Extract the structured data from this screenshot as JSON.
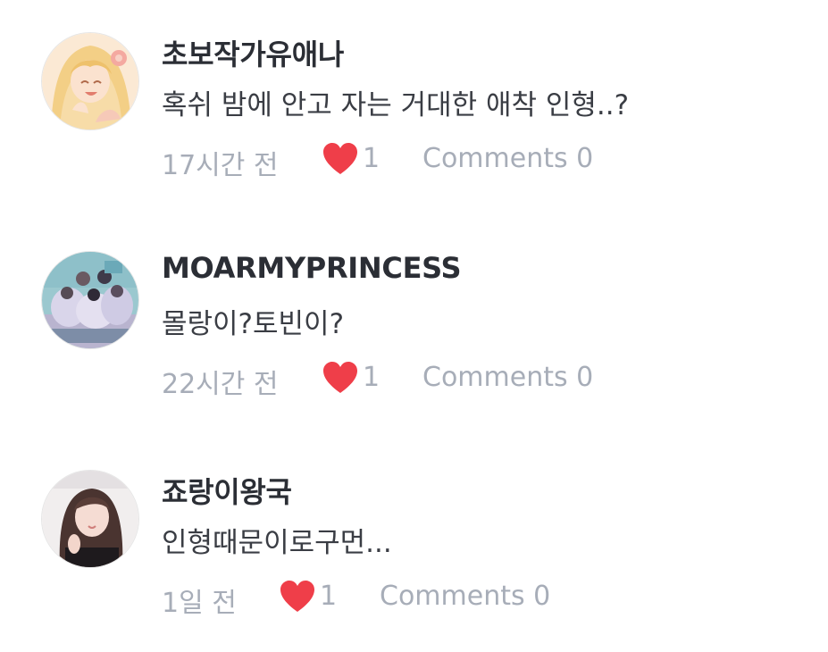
{
  "comments": [
    {
      "username": "초보작가유애나",
      "text": "혹쉬 밤에 안고 자는 거대한 애착 인형..?",
      "time": "17시간 전",
      "likes": "1",
      "comments_label": "Comments 0"
    },
    {
      "username": "MOARMYPRINCESS",
      "text": "몰랑이?토빈이?",
      "time": "22시간 전",
      "likes": "1",
      "comments_label": "Comments 0"
    },
    {
      "username": "죠랑이왕국",
      "text": "인형때문이로구먼...",
      "time": "1일 전",
      "likes": "1",
      "comments_label": "Comments 0"
    }
  ],
  "colors": {
    "heart": "#ef3e49",
    "username": "#2b2e35",
    "meta": "#a7adb8"
  },
  "icons": {
    "like": "heart-icon"
  }
}
